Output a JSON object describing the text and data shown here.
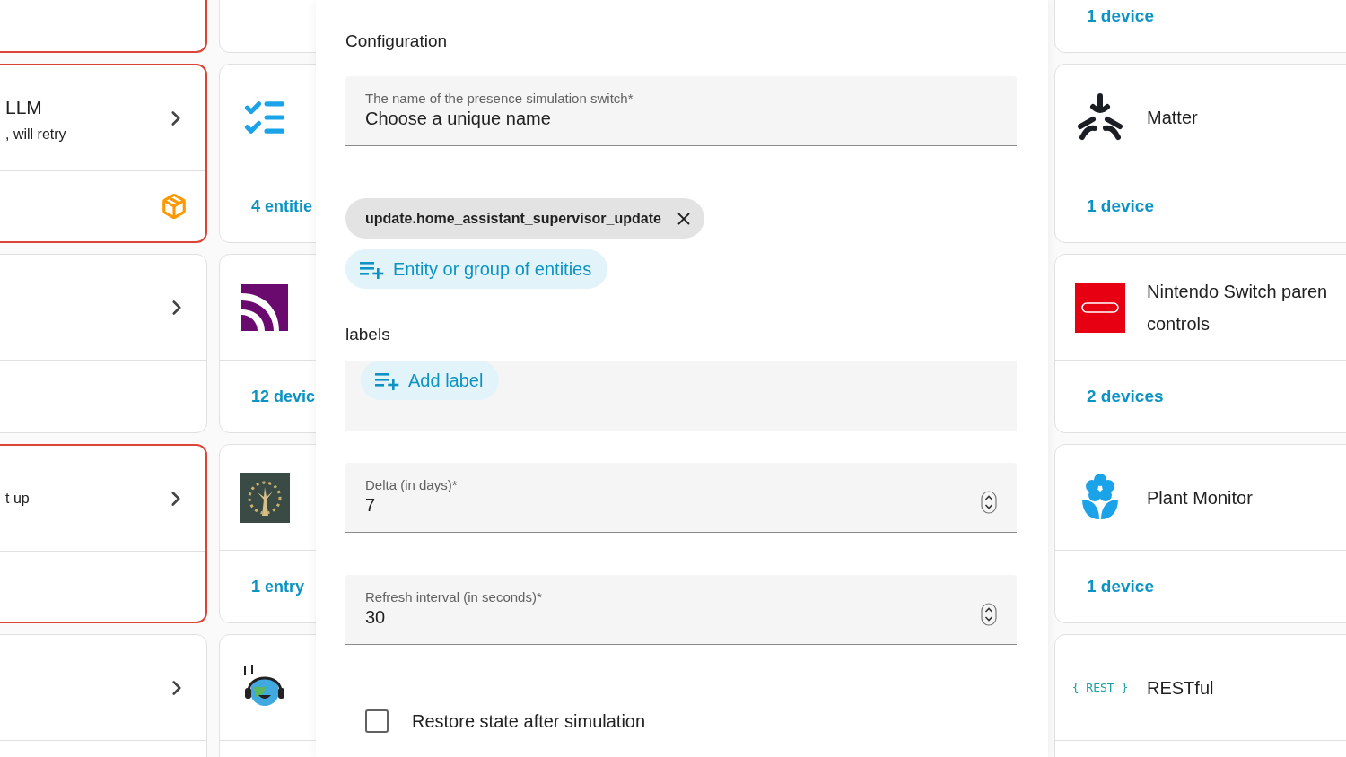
{
  "left_cards": [
    {
      "alert": true,
      "update_badge": false
    },
    {
      "alert": true,
      "title": "LLM",
      "subtitle": ", will retry",
      "chevron": true,
      "update_badge": true
    },
    {
      "alert": false,
      "chevron": true,
      "update_badge": false
    },
    {
      "alert": true,
      "subtitle": "t up",
      "chevron": true,
      "update_badge": false
    },
    {
      "alert": false,
      "chevron": true
    }
  ],
  "integration_cards_left": [
    {
      "kind": "none"
    },
    {
      "kind": "checklist",
      "footer": "4 entitie"
    },
    {
      "kind": "feed",
      "footer": "12 devic"
    },
    {
      "kind": "tree",
      "footer": "1 entry"
    },
    {
      "kind": "globe"
    }
  ],
  "dialog": {
    "heading": "Configuration",
    "name_field": {
      "label": "The name of the presence simulation switch*",
      "value": "Choose a unique name"
    },
    "entity_chips": [
      "update.home_assistant_supervisor_update"
    ],
    "add_entity_button": "Entity or group of entities",
    "labels_heading": "labels",
    "add_label_button": "Add label",
    "number_fields": [
      {
        "label": "Delta (in days)*",
        "value": "7"
      },
      {
        "label": "Refresh interval (in seconds)*",
        "value": "30"
      }
    ],
    "restore_checkbox": {
      "label": "Restore state after simulation",
      "checked": false
    }
  },
  "integration_cards_right": [
    {
      "kind": "none",
      "footer": "1 device"
    },
    {
      "kind": "matter",
      "title_lines": [
        "Matter"
      ],
      "footer": "1 device"
    },
    {
      "kind": "nintendo",
      "title_lines": [
        "Nintendo Switch paren",
        "controls"
      ],
      "footer": "2 devices"
    },
    {
      "kind": "flower",
      "title_lines": [
        "Plant Monitor"
      ],
      "footer": "1 device"
    },
    {
      "kind": "rest",
      "logo_text": "{ REST }",
      "title_lines": [
        "RESTful"
      ]
    }
  ]
}
